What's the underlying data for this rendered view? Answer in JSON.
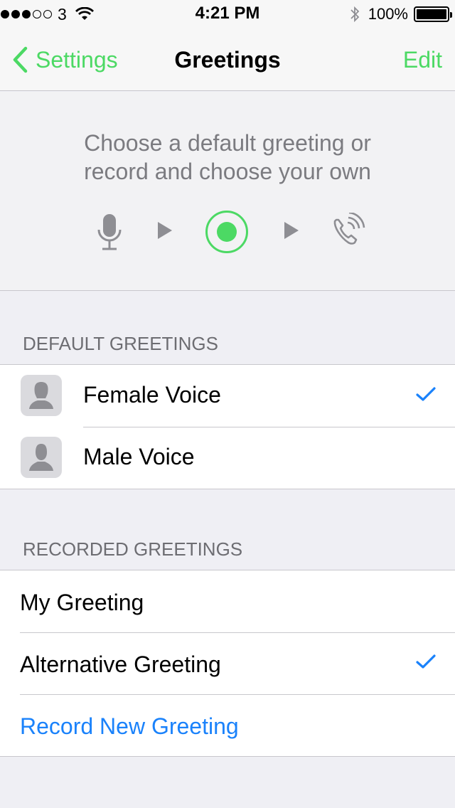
{
  "status_bar": {
    "carrier": "3",
    "time": "4:21 PM",
    "battery_percent": "100%",
    "signal_bars_filled": 3,
    "signal_bars_total": 5
  },
  "nav": {
    "back_label": "Settings",
    "title": "Greetings",
    "edit_label": "Edit"
  },
  "hero": {
    "line1": "Choose a default greeting or",
    "line2": "record and choose your own",
    "icons": [
      "microphone-icon",
      "play-arrow-icon",
      "record-icon",
      "play-arrow-icon",
      "phone-ringing-icon"
    ]
  },
  "default_section": {
    "header": "DEFAULT GREETINGS",
    "items": [
      {
        "label": "Female Voice",
        "icon": "female-avatar-icon",
        "selected": true
      },
      {
        "label": "Male Voice",
        "icon": "male-avatar-icon",
        "selected": false
      }
    ]
  },
  "recorded_section": {
    "header": "RECORDED GREETINGS",
    "items": [
      {
        "label": "My Greeting",
        "selected": false
      },
      {
        "label": "Alternative Greeting",
        "selected": true
      }
    ],
    "action_label": "Record New Greeting"
  },
  "colors": {
    "accent_green": "#4cd964",
    "link_blue": "#1a82fb",
    "checkmark_blue": "#1a82fb",
    "group_background": "#efeff4"
  }
}
